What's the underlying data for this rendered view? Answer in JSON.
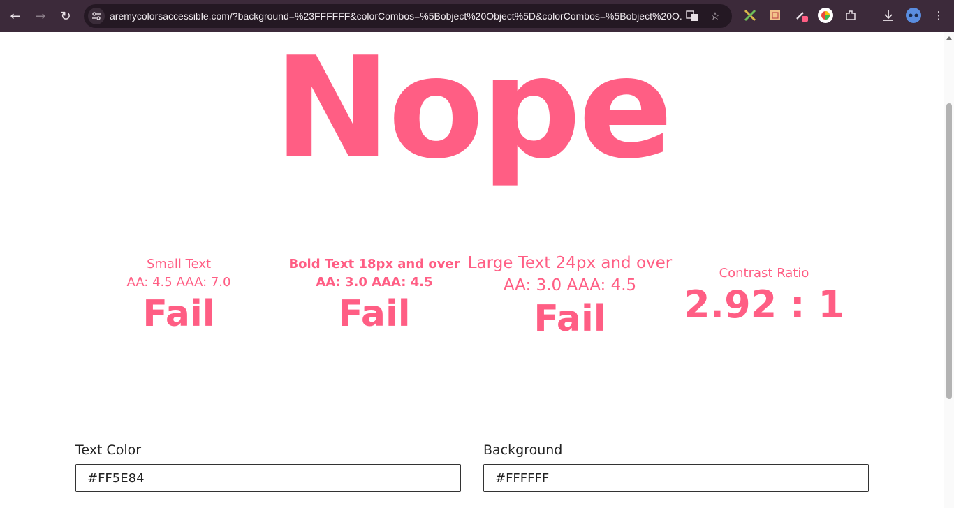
{
  "browser": {
    "url": "aremycolorsaccessible.com/?background=%23FFFFFF&colorCombos=%5Bobject%20Object%5D&colorCombos=%5Bobject%20O..."
  },
  "verdict": "Nope",
  "checks": [
    {
      "line1": "Small Text",
      "line2": "AA: 4.5 AAA: 7.0",
      "result": "Fail"
    },
    {
      "line1": "Bold Text 18px and over",
      "line2": "AA: 3.0 AAA: 4.5",
      "result": "Fail"
    },
    {
      "line1": "Large Text 24px and over",
      "line2": "AA: 3.0 AAA: 4.5",
      "result": "Fail"
    }
  ],
  "contrast": {
    "label": "Contrast Ratio",
    "value": "2.92 : 1"
  },
  "text_color": {
    "label": "Text Color",
    "value": "#FF5E84"
  },
  "background": {
    "label": "Background",
    "value": "#FFFFFF"
  },
  "colors": {
    "accent": "#FF5E84",
    "page_background": "#FFFFFF"
  }
}
